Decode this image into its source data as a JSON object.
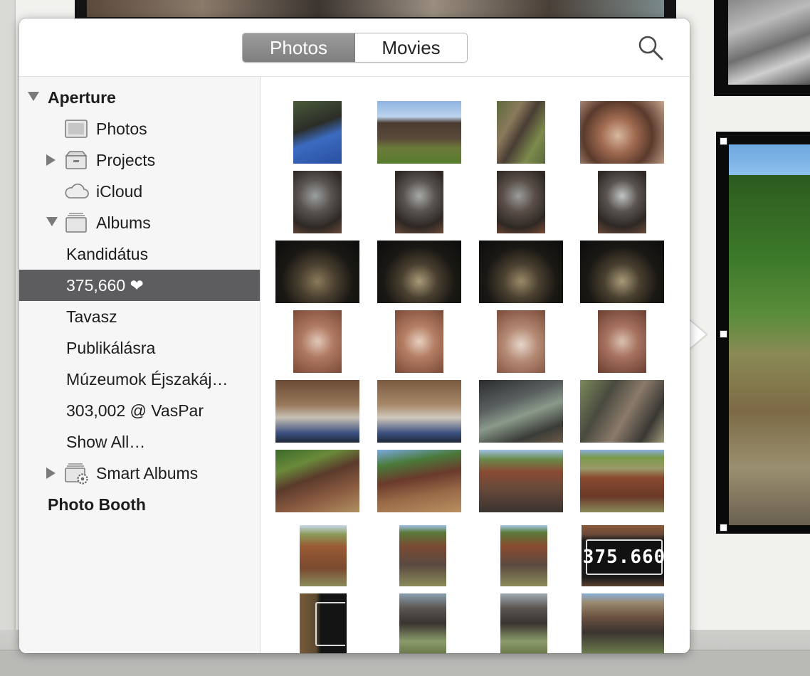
{
  "segmented": {
    "photos_label": "Photos",
    "movies_label": "Movies",
    "selected": "Photos"
  },
  "search": {
    "icon": "magnifying-glass-icon"
  },
  "sidebar": {
    "aperture_label": "Aperture",
    "items": [
      {
        "label": "Photos",
        "icon": "photos-library-icon"
      },
      {
        "label": "Projects",
        "icon": "projects-box-icon"
      },
      {
        "label": "iCloud",
        "icon": "cloud-icon"
      },
      {
        "label": "Albums",
        "icon": "albums-stack-icon"
      },
      {
        "label": "Kandidátus"
      },
      {
        "label": "375,660 ❤",
        "selected": true
      },
      {
        "label": "Tavasz"
      },
      {
        "label": "Publikálásra"
      },
      {
        "label": "Múzeumok Éjszakáj…"
      },
      {
        "label": "303,002 @ VasPar"
      },
      {
        "label": "Show All…"
      },
      {
        "label": "Smart Albums",
        "icon": "smart-albums-gear-icon"
      }
    ],
    "photo_booth_label": "Photo Booth"
  },
  "thumbnails_text": {
    "plate_number": "375.660"
  },
  "colors": {
    "selection": "#5d5d60",
    "segment_active": "#8a8a8a"
  }
}
